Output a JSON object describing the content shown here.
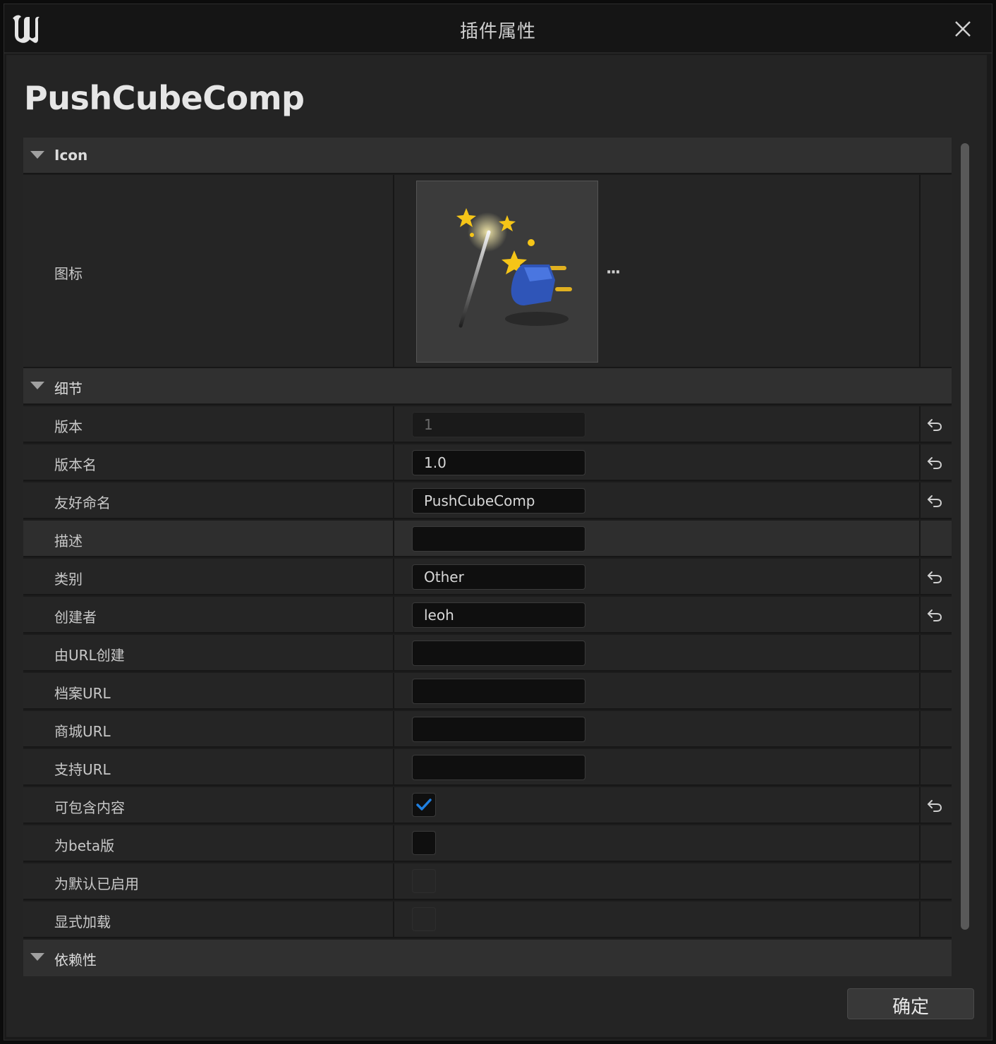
{
  "window": {
    "title": "插件属性",
    "close_icon": "close-icon",
    "logo_icon": "unreal-logo-icon"
  },
  "plugin_name": "PushCubeComp",
  "categories": {
    "icon": "Icon",
    "details": "细节",
    "dependencies": "依赖性"
  },
  "icon_row": {
    "label": "图标",
    "more": "···",
    "image_icon": "magic-wand-plugin-icon"
  },
  "rows": [
    {
      "label": "版本",
      "value": "1",
      "kind": "text",
      "disabled": true,
      "reset": true
    },
    {
      "label": "版本名",
      "value": "1.0",
      "kind": "text",
      "reset": true
    },
    {
      "label": "友好命名",
      "value": "PushCubeComp",
      "kind": "text",
      "reset": true
    },
    {
      "label": "描述",
      "value": "",
      "kind": "text",
      "reset": false,
      "highlighted": true
    },
    {
      "label": "类别",
      "value": "Other",
      "kind": "text",
      "reset": true
    },
    {
      "label": "创建者",
      "value": "leoh",
      "kind": "text",
      "reset": true
    },
    {
      "label": "由URL创建",
      "value": "",
      "kind": "text",
      "reset": false
    },
    {
      "label": "档案URL",
      "value": "",
      "kind": "text",
      "reset": false
    },
    {
      "label": "商城URL",
      "value": "",
      "kind": "text",
      "reset": false
    },
    {
      "label": "支持URL",
      "value": "",
      "kind": "text",
      "reset": false
    },
    {
      "label": "可包含内容",
      "checked": true,
      "kind": "check",
      "reset": true
    },
    {
      "label": "为beta版",
      "checked": false,
      "kind": "check",
      "reset": false
    },
    {
      "label": "为默认已启用",
      "checked": false,
      "kind": "check",
      "disabled": true,
      "reset": false
    },
    {
      "label": "显式加载",
      "checked": false,
      "kind": "check",
      "disabled": true,
      "reset": false
    }
  ],
  "reset_icon": "reset-to-default-icon",
  "ok_button": "确定",
  "colors": {
    "accent_check": "#1f7fe0",
    "background": "#242424"
  }
}
